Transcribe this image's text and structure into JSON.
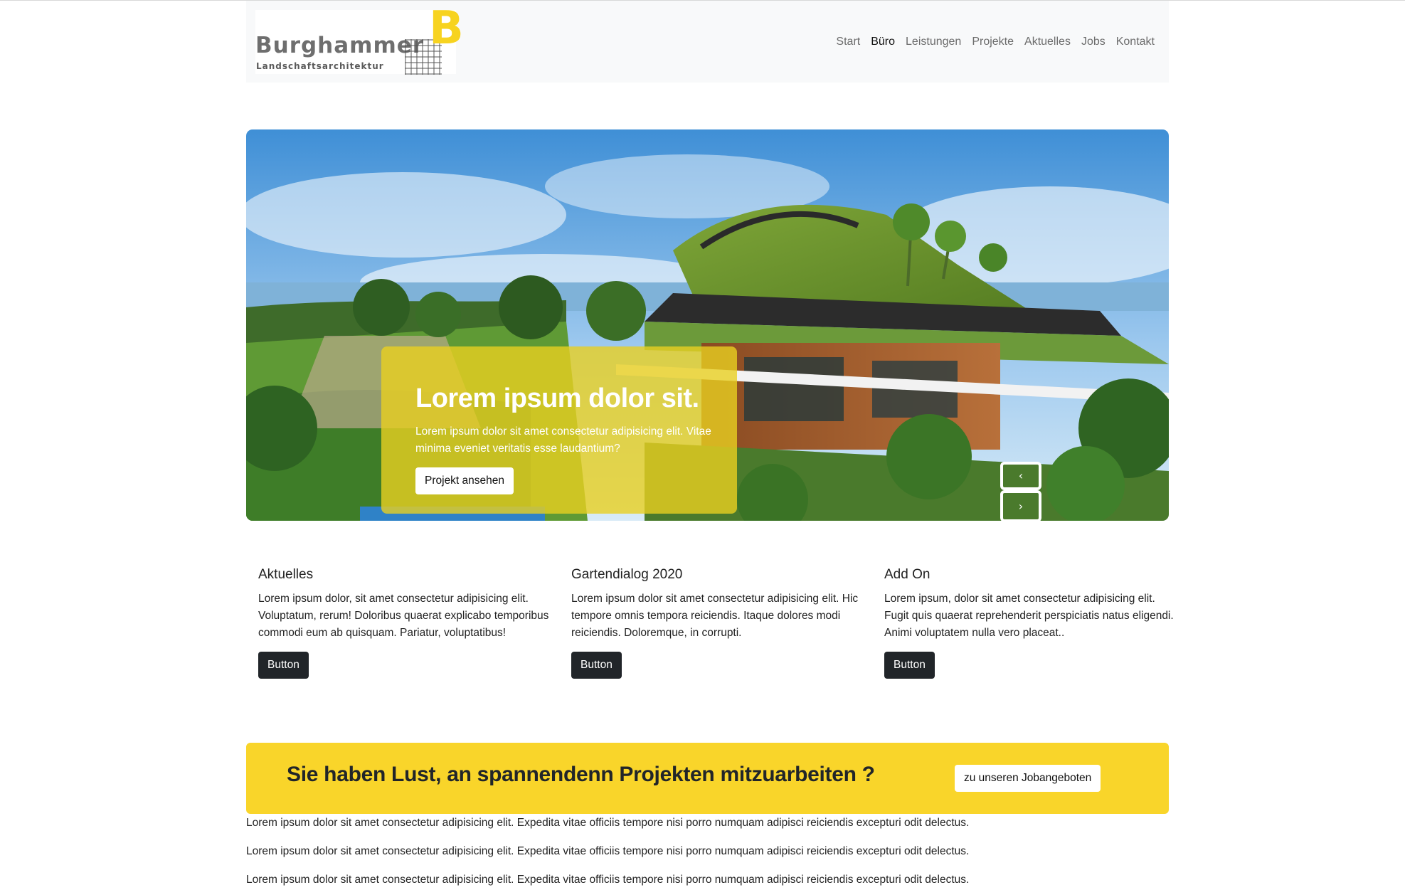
{
  "brand": {
    "name": "Burghammer",
    "subtitle": "Landschaftsarchitektur",
    "letter": "B"
  },
  "nav": {
    "items": [
      {
        "label": "Start"
      },
      {
        "label": "Büro",
        "active": true
      },
      {
        "label": "Leistungen"
      },
      {
        "label": "Projekte"
      },
      {
        "label": "Aktuelles"
      },
      {
        "label": "Jobs"
      },
      {
        "label": "Kontakt"
      }
    ]
  },
  "hero": {
    "title": "Lorem ipsum dolor sit.",
    "text": "Lorem ipsum dolor sit amet consectetur adipisicing elit. Vitae minima eveniet veritatis esse laudantium?",
    "button_label": "Projekt ansehen",
    "prev_icon": "chevron-left-icon",
    "next_icon": "chevron-right-icon"
  },
  "columns": [
    {
      "title": "Aktuelles",
      "text": "Lorem ipsum dolor, sit amet consectetur adipisicing elit. Voluptatum, rerum! Doloribus quaerat explicabo temporibus commodi eum ab quisquam. Pariatur, voluptatibus!",
      "button": "Button"
    },
    {
      "title": "Gartendialog 2020",
      "text": "Lorem ipsum dolor sit amet consectetur adipisicing elit. Hic tempore omnis tempora reiciendis. Itaque dolores modi reiciendis. Doloremque, in corrupti.",
      "button": "Button"
    },
    {
      "title": "Add On",
      "text": "Lorem ipsum, dolor sit amet consectetur adipisicing elit. Fugit quis quaerat reprehenderit perspiciatis natus eligendi. Animi voluptatem nulla vero placeat..",
      "button": "Button"
    }
  ],
  "banner": {
    "title": "Sie haben Lust, an spannendenn Projekten mitzuarbeiten ?",
    "button_label": "zu unseren Jobangeboten"
  },
  "paragraphs": [
    "Lorem ipsum dolor sit amet consectetur adipisicing elit. Expedita vitae officiis tempore nisi porro numquam adipisci reiciendis excepturi odit delectus.",
    "Lorem ipsum dolor sit amet consectetur adipisicing elit. Expedita vitae officiis tempore nisi porro numquam adipisci reiciendis excepturi odit delectus.",
    "Lorem ipsum dolor sit amet consectetur adipisicing elit. Expedita vitae officiis tempore nisi porro numquam adipisci reiciendis excepturi odit delectus."
  ],
  "colors": {
    "accent_yellow": "#f9d52a",
    "caption_yellow": "#e8d020",
    "dark_button": "#212529",
    "navbar_bg": "#f8f9fa"
  }
}
